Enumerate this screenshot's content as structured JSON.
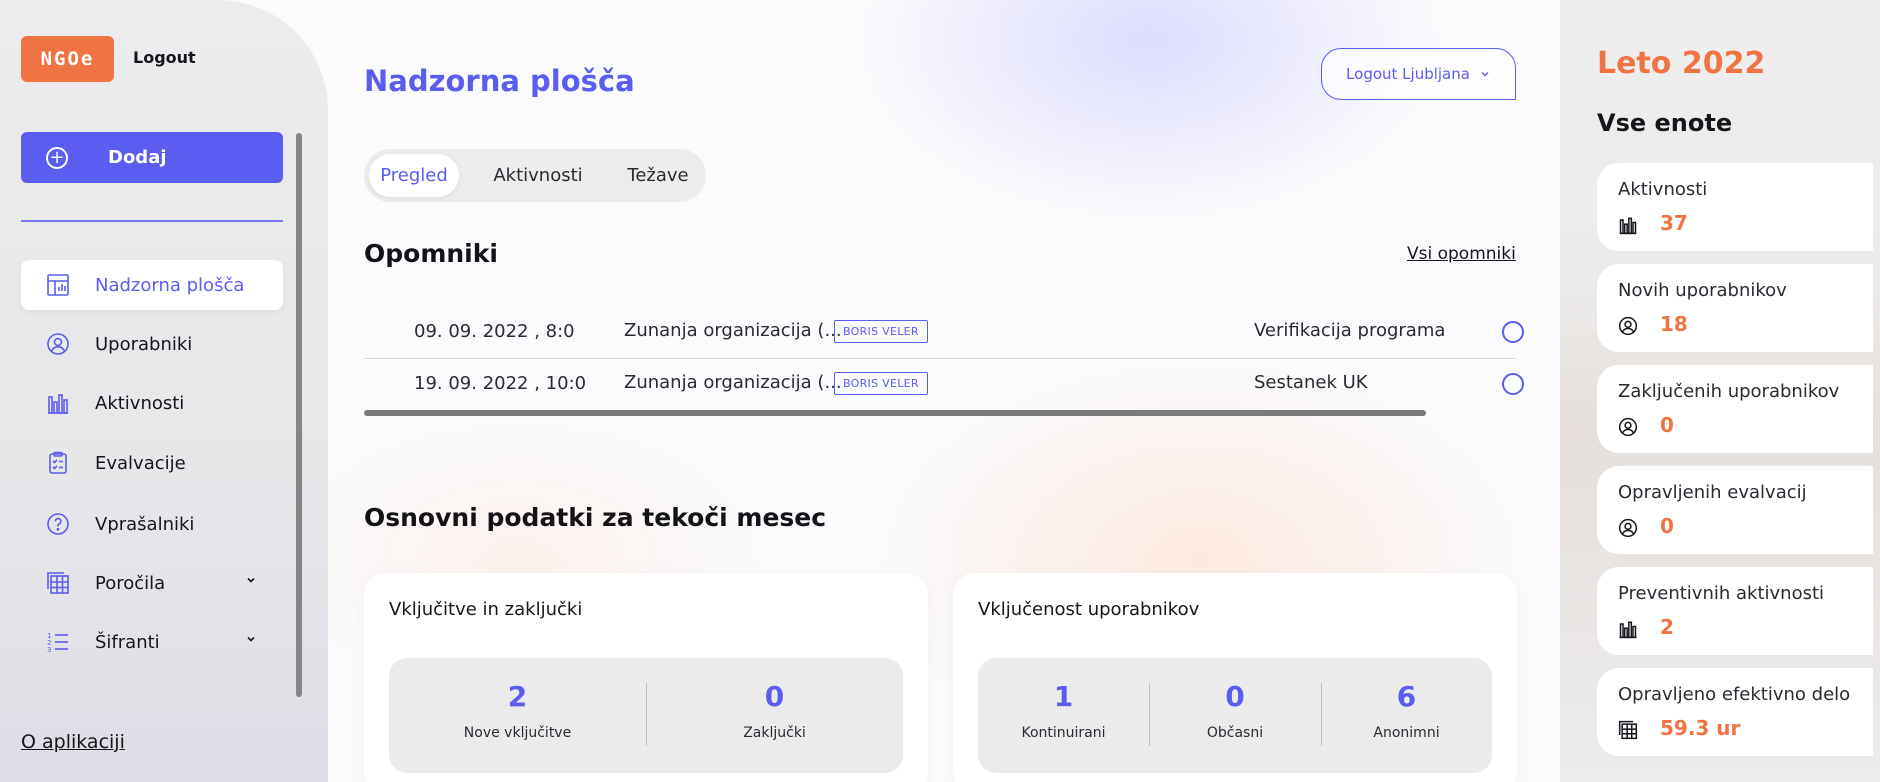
{
  "brand": {
    "logo_text": "NGOe",
    "logout_label": "Logout",
    "accent": "#5b5cf0",
    "orange": "#f07443"
  },
  "sidebar": {
    "add_label": "Dodaj",
    "items": [
      {
        "label": "Nadzorna plošča",
        "icon": "dashboard-icon",
        "active": true
      },
      {
        "label": "Uporabniki",
        "icon": "user-circle-icon"
      },
      {
        "label": "Aktivnosti",
        "icon": "bar-chart-icon"
      },
      {
        "label": "Evalvacije",
        "icon": "clipboard-icon"
      },
      {
        "label": "Vprašalniki",
        "icon": "question-icon"
      },
      {
        "label": "Poročila",
        "icon": "table-icon",
        "expandable": true
      },
      {
        "label": "Šifranti",
        "icon": "numbered-list-icon",
        "expandable": true
      }
    ],
    "about_label": "O aplikaciji"
  },
  "header": {
    "title": "Nadzorna plošča",
    "city_button": "Logout Ljubljana"
  },
  "tabs": [
    {
      "label": "Pregled",
      "active": true
    },
    {
      "label": "Aktivnosti"
    },
    {
      "label": "Težave"
    }
  ],
  "reminders": {
    "title": "Opomniki",
    "all_link": "Vsi opomniki",
    "rows": [
      {
        "date": "09. 09. 2022 , 8:0",
        "org": "Zunanja organizacija (...",
        "badge": "BORIS VELER",
        "type": "Verifikacija programa"
      },
      {
        "date": "19. 09. 2022 , 10:0",
        "org": "Zunanja organizacija (...",
        "badge": "BORIS VELER",
        "type": "Sestanek UK"
      }
    ]
  },
  "monthly": {
    "title": "Osnovni podatki za tekoči mesec",
    "cards": [
      {
        "title": "Vključitve in zaključki",
        "stats": [
          {
            "value": "2",
            "label": "Nove vključitve"
          },
          {
            "value": "0",
            "label": "Zaključki"
          }
        ]
      },
      {
        "title": "Vključenost uporabnikov",
        "stats": [
          {
            "value": "1",
            "label": "Kontinuirani"
          },
          {
            "value": "0",
            "label": "Občasni"
          },
          {
            "value": "6",
            "label": "Anonimni"
          }
        ]
      }
    ]
  },
  "right_panel": {
    "season": "Leto 2022",
    "units": "Vse enote",
    "stats": [
      {
        "title": "Aktivnosti",
        "value": "37",
        "icon": "bar-chart-icon"
      },
      {
        "title": "Novih uporabnikov",
        "value": "18",
        "icon": "user-circle-icon"
      },
      {
        "title": "Zaključenih uporabnikov",
        "value": "0",
        "icon": "user-circle-icon"
      },
      {
        "title": "Opravljenih evalvacij",
        "value": "0",
        "icon": "user-circle-icon"
      },
      {
        "title": "Preventivnih aktivnosti",
        "value": "2",
        "icon": "bar-chart-icon"
      },
      {
        "title": "Opravljeno efektivno delo",
        "value": "59.3 ur",
        "icon": "table-icon"
      }
    ]
  }
}
